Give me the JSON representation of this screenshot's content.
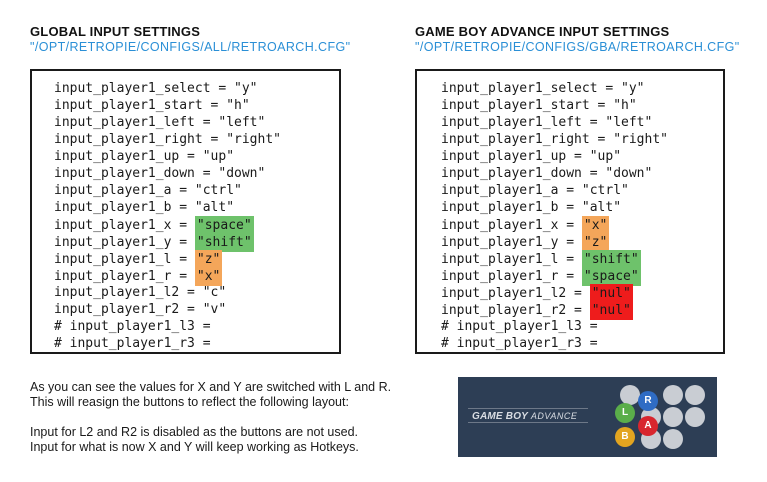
{
  "global": {
    "title": "GLOBAL INPUT SETTINGS",
    "path": "\"/OPT/RETROPIE/CONFIGS/ALL/RETROARCH.CFG\"",
    "lines": [
      {
        "key": "input_player1_select",
        "value": "\"y\""
      },
      {
        "key": "input_player1_start",
        "value": "\"h\""
      },
      {
        "key": "input_player1_left",
        "value": "\"left\""
      },
      {
        "key": "input_player1_right",
        "value": "\"right\""
      },
      {
        "key": "input_player1_up",
        "value": "\"up\""
      },
      {
        "key": "input_player1_down",
        "value": "\"down\""
      },
      {
        "key": "input_player1_a",
        "value": "\"ctrl\""
      },
      {
        "key": "input_player1_b",
        "value": "\"alt\""
      },
      {
        "key": "input_player1_x",
        "value": "\"space\"",
        "highlight": "green"
      },
      {
        "key": "input_player1_y",
        "value": "\"shift\"",
        "highlight": "green"
      },
      {
        "key": "input_player1_l",
        "value": "\"z\"",
        "highlight": "orange"
      },
      {
        "key": "input_player1_r",
        "value": "\"x\"",
        "highlight": "orange"
      },
      {
        "key": "input_player1_l2",
        "value": "\"c\""
      },
      {
        "key": "input_player1_r2",
        "value": "\"v\""
      },
      {
        "comment": "# input_player1_l3 ="
      },
      {
        "comment": "# input_player1_r3 ="
      }
    ]
  },
  "gba": {
    "title": "GAME BOY ADVANCE INPUT SETTINGS",
    "path": "\"/OPT/RETROPIE/CONFIGS/GBA/RETROARCH.CFG\"",
    "lines": [
      {
        "key": "input_player1_select",
        "value": "\"y\""
      },
      {
        "key": "input_player1_start",
        "value": "\"h\""
      },
      {
        "key": "input_player1_left",
        "value": "\"left\""
      },
      {
        "key": "input_player1_right",
        "value": "\"right\""
      },
      {
        "key": "input_player1_up",
        "value": "\"up\""
      },
      {
        "key": "input_player1_down",
        "value": "\"down\""
      },
      {
        "key": "input_player1_a",
        "value": "\"ctrl\""
      },
      {
        "key": "input_player1_b",
        "value": "\"alt\""
      },
      {
        "key": "input_player1_x",
        "value": "\"x\"",
        "highlight": "orange"
      },
      {
        "key": "input_player1_y",
        "value": "\"z\"",
        "highlight": "orange"
      },
      {
        "key": "input_player1_l",
        "value": "\"shift\"",
        "highlight": "green"
      },
      {
        "key": "input_player1_r",
        "value": "\"space\"",
        "highlight": "green"
      },
      {
        "key": "input_player1_l2",
        "value": "\"nul\"",
        "highlight": "red"
      },
      {
        "key": "input_player1_r2",
        "value": "\"nul\"",
        "highlight": "red"
      },
      {
        "comment": "# input_player1_l3 ="
      },
      {
        "comment": "# input_player1_r3 ="
      }
    ]
  },
  "description": {
    "line1": "As you can see the values for X and Y are switched with L and R.",
    "line2": "This will reasign the buttons to reflect the following layout:",
    "line3": "Input for L2 and R2 is disabled as the buttons are not used.",
    "line4": "Input for what is now X and Y will keep working as Hotkeys."
  },
  "controller": {
    "logo_main": "GAME BOY",
    "logo_sub": "ADVANCE",
    "buttons": [
      {
        "label": "L",
        "color": "#5aae4a"
      },
      {
        "label": "R",
        "color": "#2f6cc4"
      },
      {
        "label": "B",
        "color": "#e3a520"
      },
      {
        "label": "A",
        "color": "#d8262e"
      }
    ]
  },
  "colors": {
    "highlight_green": "#6ec26b",
    "highlight_orange": "#f4a65a",
    "highlight_red": "#ee1c1c",
    "path_blue": "#2a8fd6",
    "controller_bg": "#2d3e55"
  }
}
